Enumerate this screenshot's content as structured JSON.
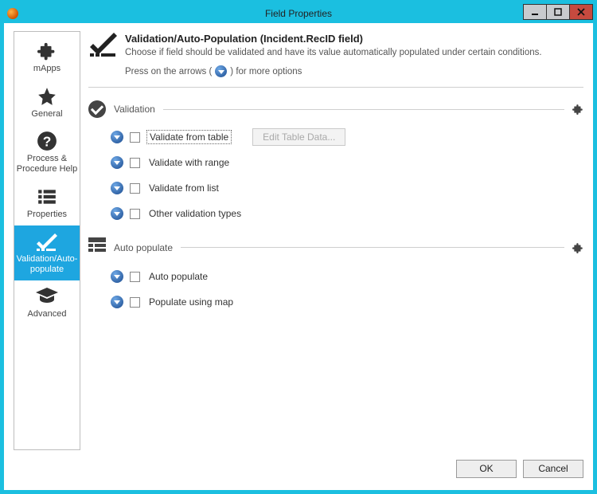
{
  "window": {
    "title": "Field Properties"
  },
  "sidebar": {
    "items": [
      {
        "label": "mApps"
      },
      {
        "label": "General"
      },
      {
        "label": "Process & Procedure Help"
      },
      {
        "label": "Properties"
      },
      {
        "label": "Validation/Auto-populate"
      },
      {
        "label": "Advanced"
      }
    ]
  },
  "header": {
    "title": "Validation/Auto-Population (Incident.RecID field)",
    "subtitle": "Choose if field should be validated and have its value automatically populated under certain conditions.",
    "more_prefix": "Press on the arrows (",
    "more_suffix": ") for more options"
  },
  "sections": {
    "validation": {
      "title": "Validation",
      "options": [
        {
          "label": "Validate from table",
          "button": "Edit Table Data..."
        },
        {
          "label": "Validate with range"
        },
        {
          "label": "Validate from list"
        },
        {
          "label": "Other validation types"
        }
      ]
    },
    "autopopulate": {
      "title": "Auto populate",
      "options": [
        {
          "label": "Auto populate"
        },
        {
          "label": "Populate using map"
        }
      ]
    }
  },
  "footer": {
    "ok": "OK",
    "cancel": "Cancel"
  }
}
